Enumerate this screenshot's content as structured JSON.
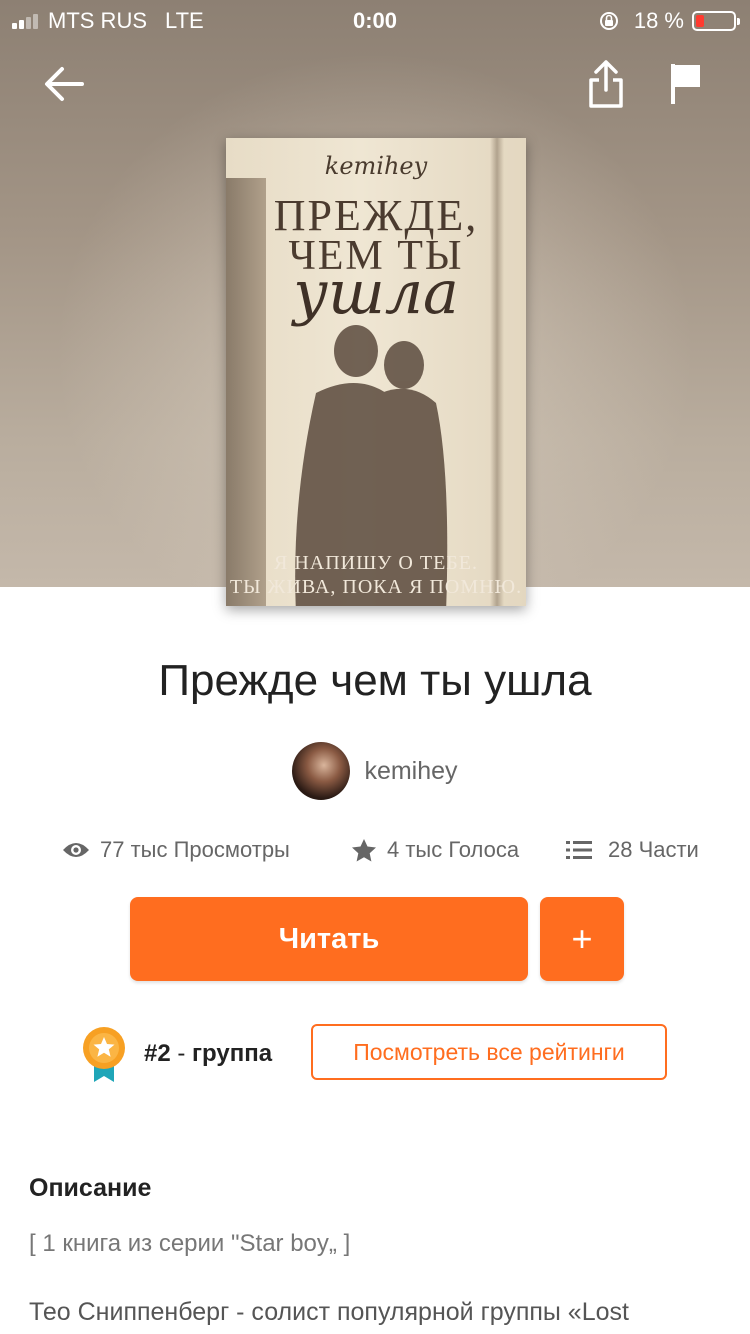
{
  "status_bar": {
    "carrier": "MTS RUS",
    "network": "LTE",
    "time": "0:00",
    "battery": "18 %",
    "battery_level": 0.18
  },
  "nav": {
    "back_icon": "arrow-left-icon",
    "share_icon": "share-icon",
    "report_icon": "flag-icon"
  },
  "cover": {
    "author": "kemihey",
    "title_line1": "ПРЕЖДЕ,",
    "title_line2": "ЧЕМ ТЫ",
    "title_line3": "ушла",
    "tagline1": "Я НАПИШУ О ТЕБЕ.",
    "tagline2": "ТЫ ЖИВА, ПОКА Я ПОМНЮ."
  },
  "story": {
    "title": "Прежде чем ты ушла",
    "author": "kemihey"
  },
  "stats": {
    "views": "77 тыс Просмотры",
    "votes": "4 тыс Голоса",
    "parts": "28 Части"
  },
  "actions": {
    "read": "Читать",
    "add": "+"
  },
  "ranking": {
    "rank": "#2",
    "separator": " - ",
    "tag": "группа",
    "button": "Посмотреть все рейтинги"
  },
  "description": {
    "heading": "Описание",
    "series": "[ 1 книга из серии \"Star boy„ ]",
    "text": "Тео Сниппенберг - солист  популярной группы «Lost"
  },
  "colors": {
    "accent": "#ff6d1f"
  }
}
